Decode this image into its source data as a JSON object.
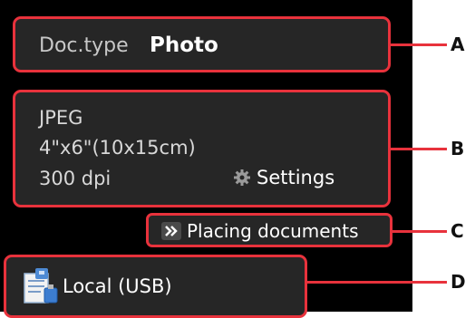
{
  "doc_type": {
    "label": "Doc.type",
    "value": "Photo"
  },
  "scan_settings": {
    "format": "JPEG",
    "size": "4\"x6\"(10x15cm)",
    "resolution": "300 dpi",
    "settings_label": "Settings"
  },
  "placing_documents_label": "Placing documents",
  "save_location": "Local (USB)",
  "callouts": [
    "A",
    "B",
    "C",
    "D"
  ],
  "colors": {
    "highlight": "#e8323c",
    "panel": "#262626",
    "screen": "#000000"
  },
  "icons": [
    "gear-icon",
    "double-chevron-right-icon",
    "usb-storage-icon"
  ]
}
